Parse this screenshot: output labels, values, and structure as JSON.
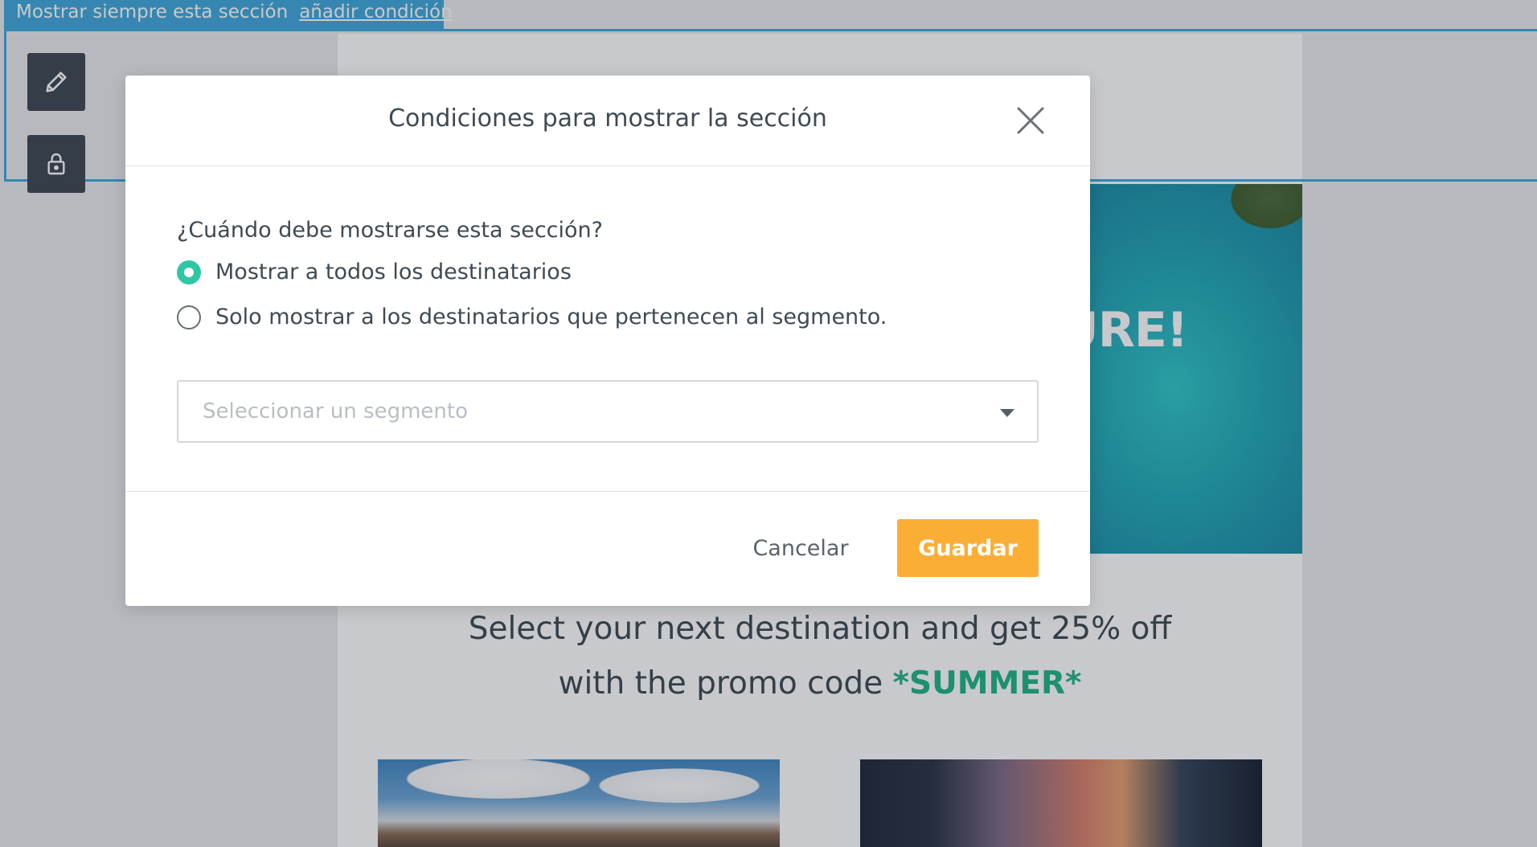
{
  "section_bar": {
    "status": "Mostrar siempre esta sección",
    "add_condition": "añadir condición"
  },
  "toolbar": {
    "edit_icon": "pencil-icon",
    "lock_icon": "lock-icon"
  },
  "email": {
    "hero_text": "URE!",
    "promo_line1": "Select your next destination and get 25% off",
    "promo_line2_prefix": "with the promo code ",
    "promo_code": "*SUMMER*"
  },
  "modal": {
    "title": "Condiciones para mostrar la sección",
    "close_icon": "close-icon",
    "question": "¿Cuándo debe mostrarse esta sección?",
    "options": [
      {
        "label": "Mostrar a todos los destinatarios",
        "checked": true
      },
      {
        "label": "Solo mostrar a los destinatarios que pertenecen al segmento.",
        "checked": false
      }
    ],
    "segment_select": {
      "placeholder": "Seleccionar un segmento"
    },
    "cancel_label": "Cancelar",
    "save_label": "Guardar"
  },
  "colors": {
    "accent_blue": "#3fa9dc",
    "radio_green": "#2fc6a6",
    "save_orange": "#fbae35",
    "promo_green": "#1fb487"
  }
}
